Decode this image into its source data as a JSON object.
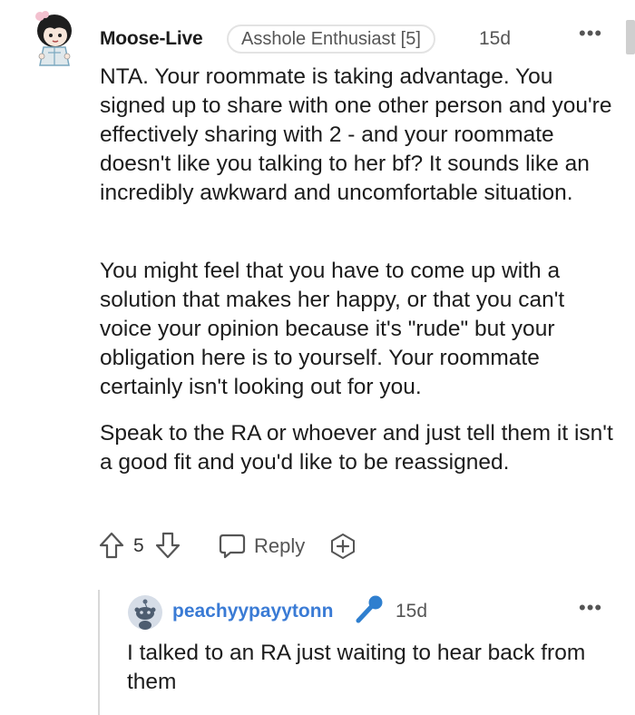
{
  "comment": {
    "username": "Moose-Live",
    "flair": "Asshole Enthusiast [5]",
    "age": "15d",
    "more": "•••",
    "paragraphs": [
      "NTA. Your roommate is taking advantage. You signed up to share with one other person and you're effectively sharing with 2 - and your roommate doesn't like you talking to her bf? It sounds like an incredibly awkward and uncomfortable situation.",
      "You might feel that you have to come up with a solution that makes her happy, or that you can't voice your opinion because it's \"rude\" but your obligation here is to yourself. Your roommate certainly isn't looking out for you.",
      "Speak to the RA or whoever and just tell them it isn't a good fit and you'd like to be reassigned."
    ],
    "actions": {
      "score": "5",
      "reply_label": "Reply"
    }
  },
  "reply": {
    "username": "peachyypayytonn",
    "age": "15d",
    "more": "•••",
    "text": "I talked to an RA just waiting to hear back from them"
  },
  "colors": {
    "reply_username": "#3a7bd5",
    "mic_icon": "#2f7fcf",
    "text": "#1c1c1c",
    "muted": "#555555"
  },
  "icons": [
    "avatar",
    "upvote-icon",
    "downvote-icon",
    "reply-icon",
    "award-icon",
    "microphone-icon",
    "snoo-avatar-icon"
  ]
}
